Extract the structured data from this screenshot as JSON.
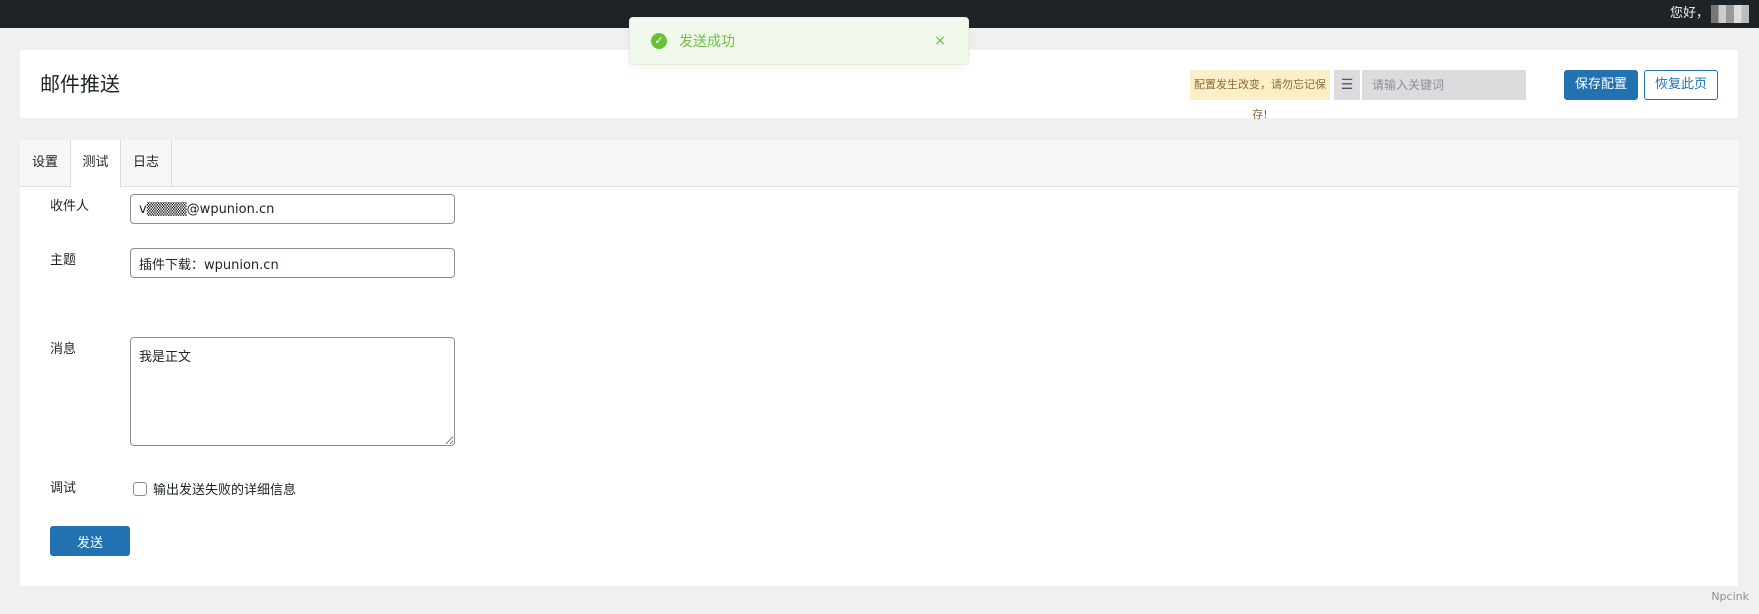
{
  "adminbar": {
    "greeting": "您好，"
  },
  "toast": {
    "message": "发送成功",
    "close": "×"
  },
  "header": {
    "title": "邮件推送",
    "notice": "配置发生改变，请勿忘记保存!",
    "indent_icon": "☰",
    "search_placeholder": "请输入关键词",
    "save_label": "保存配置",
    "reset_label": "恢复此页"
  },
  "tabs": [
    {
      "label": "设置"
    },
    {
      "label": "测试"
    },
    {
      "label": "日志"
    }
  ],
  "form": {
    "recipient": {
      "label": "收件人",
      "value": "v▒▒▒▒@wpunion.cn"
    },
    "subject": {
      "label": "主题",
      "value": "插件下载：wpunion.cn"
    },
    "message": {
      "label": "消息",
      "value": "我是正文"
    },
    "debug": {
      "label": "调试",
      "option": "输出发送失败的详细信息"
    },
    "send_label": "发送"
  },
  "footer": {
    "brand": "Npcink"
  },
  "colors": {
    "accent": "#2271b1",
    "success": "#67c23a",
    "notice_bg": "#fcefc7"
  }
}
